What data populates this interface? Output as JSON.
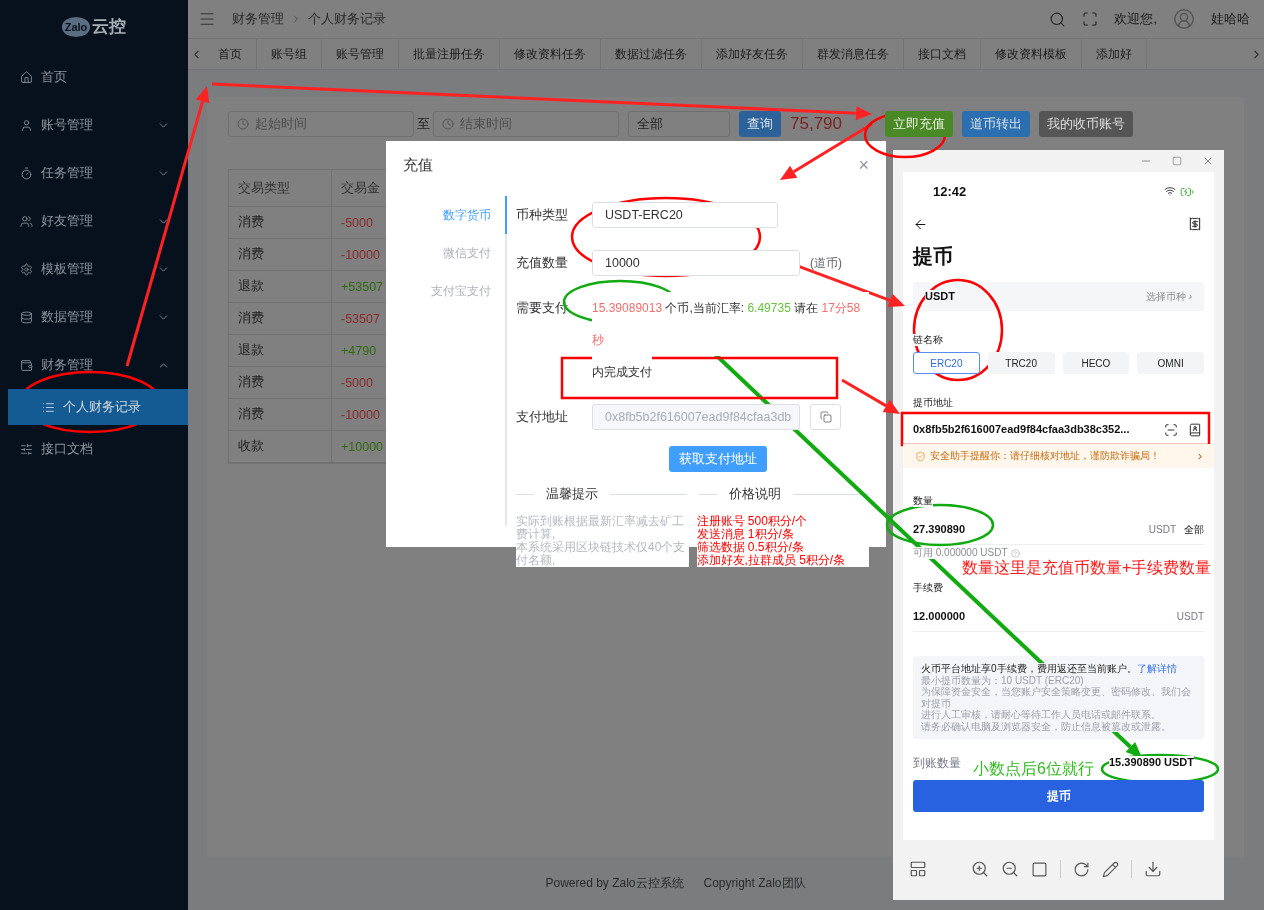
{
  "sidebar": {
    "logo_mark": "Zalo",
    "logo_text": "云控",
    "items": [
      {
        "label": "首页"
      },
      {
        "label": "账号管理",
        "expanded": false
      },
      {
        "label": "任务管理",
        "expanded": false
      },
      {
        "label": "好友管理",
        "expanded": false
      },
      {
        "label": "模板管理",
        "expanded": false
      },
      {
        "label": "数据管理",
        "expanded": false
      },
      {
        "label": "财务管理",
        "expanded": true,
        "children": [
          {
            "label": "个人财务记录",
            "selected": true
          }
        ]
      },
      {
        "label": "接口文档"
      }
    ]
  },
  "header": {
    "breadcrumb": [
      "财务管理",
      "个人财务记录"
    ],
    "welcome": "欢迎您,",
    "user": "娃哈哈"
  },
  "tabs": [
    "首页",
    "账号组",
    "账号管理",
    "批量注册任务",
    "修改资料任务",
    "数据过滤任务",
    "添加好友任务",
    "群发消息任务",
    "接口文档",
    "修改资料模板",
    "添加好"
  ],
  "filters": {
    "start_placeholder": "起始时间",
    "separator": "至",
    "end_placeholder": "结束时间",
    "type_select": "全部",
    "query": "查询",
    "balance": "75,790",
    "recharge": "立即充值",
    "transfer": "道币转出",
    "accounts": "我的收币账号"
  },
  "table": {
    "columns": [
      "交易类型",
      "交易金"
    ],
    "rows": [
      {
        "type": "消费",
        "amount": "-5000",
        "kind": "expense"
      },
      {
        "type": "消费",
        "amount": "-10000",
        "kind": "expense"
      },
      {
        "type": "退款",
        "amount": "+53507",
        "kind": "income"
      },
      {
        "type": "消费",
        "amount": "-53507",
        "kind": "expense"
      },
      {
        "type": "退款",
        "amount": "+4790",
        "kind": "income"
      },
      {
        "type": "消费",
        "amount": "-5000",
        "kind": "expense"
      },
      {
        "type": "消费",
        "amount": "-10000",
        "kind": "expense"
      },
      {
        "type": "收款",
        "amount": "+10000",
        "kind": "income"
      }
    ]
  },
  "footer": {
    "powered": "Powered by Zalo云控系统",
    "copyright": "Copyright Zalo团队"
  },
  "modal": {
    "title": "充值",
    "close": "×",
    "methods": [
      {
        "label": "数字货币",
        "selected": true
      },
      {
        "label": "微信支付",
        "selected": false
      },
      {
        "label": "支付宝支付",
        "selected": false
      }
    ],
    "currency_label": "币种类型",
    "currency": "USDT-ERC20",
    "amount_label": "充值数量",
    "amount": "10000",
    "amount_unit": "(道币)",
    "pay_label": "需要支付",
    "pay": {
      "amount": "15.39089013",
      "unit_text": "个币,当前汇率:",
      "rate": "6.49735",
      "before_time": "请在",
      "time": "17分58秒",
      "after_time": "内完成支付"
    },
    "address_label": "支付地址",
    "address": "0x8fb5b2f616007ead9f84cfaa3db",
    "get_address": "获取支付地址",
    "tips_title": "温馨提示",
    "tips": [
      "实际到账根据最新汇率减去矿工费计算,",
      "本系统采用区块链技术仅40个支付名额,"
    ],
    "price_title": "价格说明",
    "prices": [
      "注册账号 500积分/个",
      "发送消息 1积分/条",
      "筛选数据 0.5积分/条",
      "添加好友,拉群成员 5积分/条"
    ]
  },
  "phone": {
    "time": "12:42",
    "title": "提币",
    "coin": "USDT",
    "coin_picker": "选择币种 ›",
    "chain_label": "链名称",
    "chains": [
      {
        "label": "ERC20",
        "selected": true
      },
      {
        "label": "TRC20",
        "selected": false
      },
      {
        "label": "HECO",
        "selected": false
      },
      {
        "label": "OMNI",
        "selected": false
      }
    ],
    "address_label": "提币地址",
    "address": "0x8fb5b2f616007ead9f84cfaa3db38c352...",
    "warning": "安全助手提醒你：请仔细核对地址，谨防欺诈骗局！",
    "warning_arrow": "›",
    "quantity_label": "数量",
    "quantity": "27.390890",
    "quantity_unit": "USDT",
    "all": "全部",
    "available": "可用 0.000000 USDT",
    "fee_label": "手续费",
    "fee": "12.000000",
    "fee_unit": "USDT",
    "info_main": "火币平台地址享0手续费，费用返还至当前账户。",
    "info_link": "了解详情",
    "info_lines": [
      "最小提币数量为：10 USDT (ERC20)",
      "为保障资金安全，当您账户安全策略变更、密码修改、我们会对提币",
      "进行人工审核，请耐心等待工作人员电话或邮件联系。",
      "请务必确认电脑及浏览器安全，防止信息被篡改或泄露。"
    ],
    "received_label": "到账数量",
    "received": "15.390890 USDT",
    "submit": "提币"
  },
  "annotations": {
    "sum_note": "数量这里是充值币数量+手续费数量",
    "decimals_note": "小数点后6位就行"
  }
}
